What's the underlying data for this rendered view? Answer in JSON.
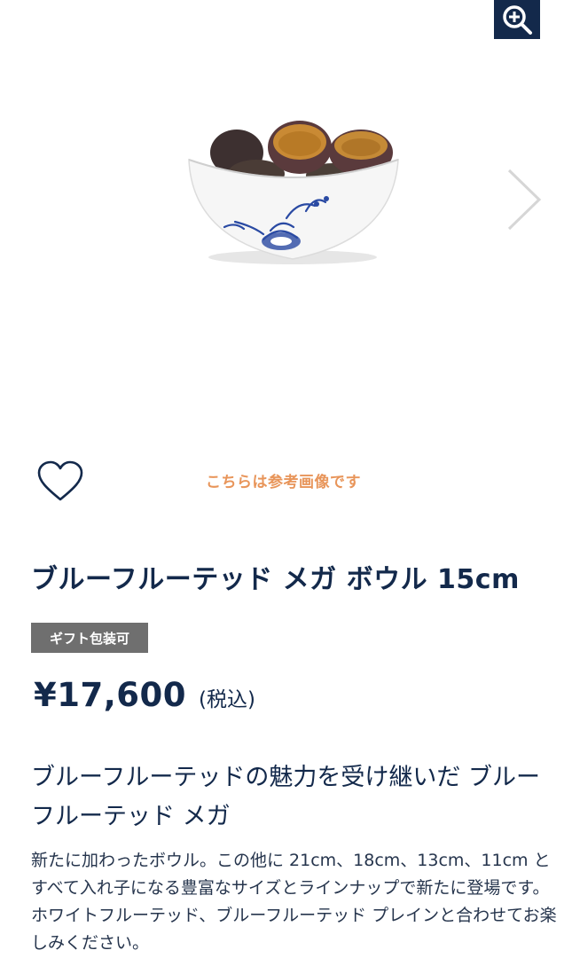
{
  "gallery": {
    "zoom_icon": "zoom-in-icon",
    "next_icon": "chevron-right-icon",
    "image_name": "product-image"
  },
  "favorite": {
    "icon": "heart-icon"
  },
  "reference_note": "こちらは参考画像です",
  "product": {
    "title": "ブルーフルーテッド メガ ボウル 15cm",
    "badge": "ギフト包装可",
    "price": "¥17,600",
    "tax_note": "(税込)",
    "headline": "ブルーフルーテッドの魅力を受け継いだ ブルーフルーテッド メガ",
    "description": "新たに加わったボウル。この他に 21cm、18cm、13cm、11cm とすべて入れ子になる豊富なサイズとラインナップで新たに登場です。ホワイトフルーテッド、ブルーフルーテッド プレインと合わせてお楽しみください。"
  },
  "colors": {
    "navy": "#13294b",
    "accent_orange": "#e8955a",
    "badge_gray": "#6f6f6f"
  }
}
